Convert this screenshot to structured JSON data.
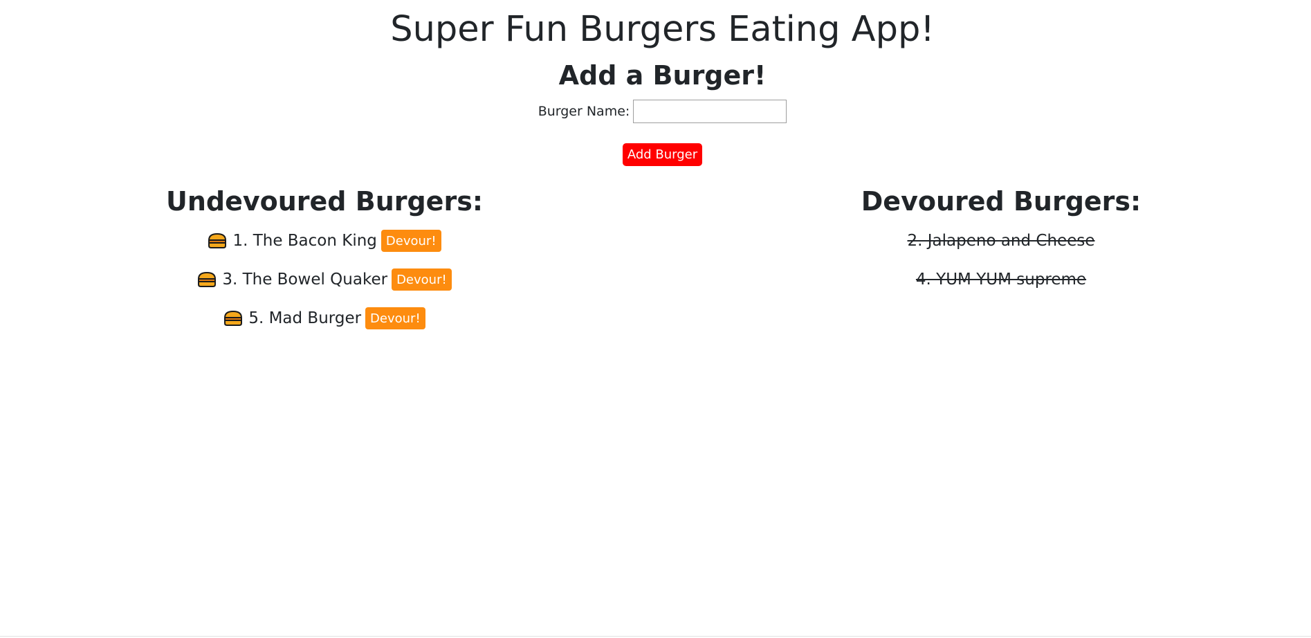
{
  "header": {
    "title": "Super Fun Burgers Eating App!",
    "subtitle": "Add a Burger!"
  },
  "form": {
    "label": "Burger Name:",
    "value": "",
    "placeholder": "",
    "submit_label": "Add Burger"
  },
  "colors": {
    "add_button": "#ff0000",
    "devour_button": "#fd8c0f",
    "burger_icon": "#f5a81c"
  },
  "undevoured": {
    "heading": "Undevoured Burgers:",
    "items": [
      {
        "label": "1. The Bacon King",
        "button": "Devour!",
        "icon": "burger-icon"
      },
      {
        "label": "3. The Bowel Quaker",
        "button": "Devour!",
        "icon": "burger-icon"
      },
      {
        "label": "5. Mad Burger",
        "button": "Devour!",
        "icon": "burger-icon"
      }
    ]
  },
  "devoured": {
    "heading": "Devoured Burgers:",
    "items": [
      {
        "label": "2. Jalapeno and Cheese"
      },
      {
        "label": "4. YUM YUM supreme"
      }
    ]
  }
}
